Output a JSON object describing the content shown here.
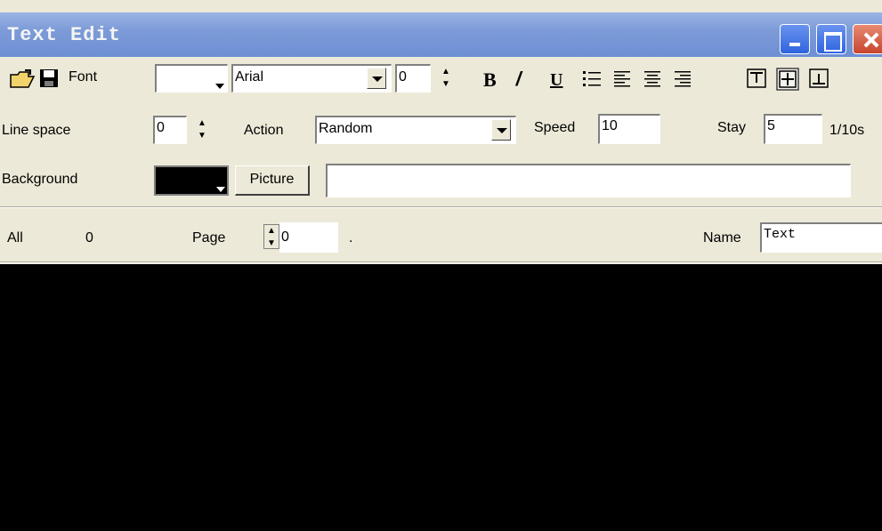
{
  "window": {
    "title": "Text Edit"
  },
  "toolbar": {
    "font_label": "Font",
    "font_name": "Arial",
    "font_size": "0",
    "bold_glyph": "B",
    "italic_glyph": "/",
    "underline_glyph": "U",
    "icons": [
      "open-folder-icon",
      "save-disk-icon",
      "bullet-list-icon",
      "align-left-icon",
      "align-center-icon",
      "align-right-icon",
      "valign-top-icon",
      "valign-middle-icon",
      "valign-bottom-icon"
    ]
  },
  "line2": {
    "line_space_label": "Line space",
    "line_space_value": "0",
    "action_label": "Action",
    "action_value": "Random",
    "speed_label": "Speed",
    "speed_value": "10",
    "stay_label": "Stay",
    "stay_value": "5",
    "stay_unit": "1/10s"
  },
  "line3": {
    "background_label": "Background",
    "background_color": "#000000",
    "picture_button": "Picture",
    "picture_path": ""
  },
  "status": {
    "all_label": "All",
    "all_value": "0",
    "page_label": "Page",
    "page_value": "0",
    "page_suffix": ".",
    "name_label": "Name",
    "name_value": "Text"
  },
  "colors": {
    "titlebar": "#7d9bd8",
    "panel": "#ece9d8",
    "canvas": "#000000"
  }
}
